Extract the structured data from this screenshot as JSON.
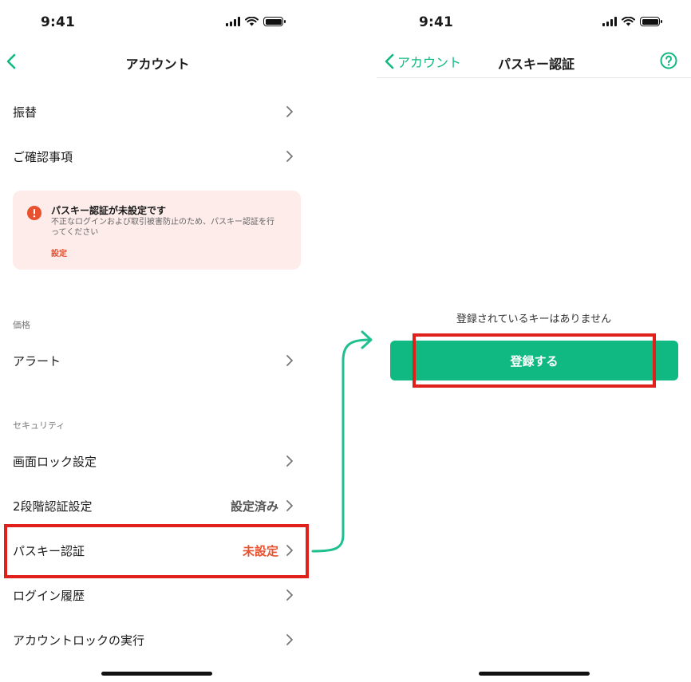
{
  "left_screen": {
    "status_time": "9:41",
    "nav_title": "アカウント",
    "rows_top": [
      {
        "label": "振替"
      },
      {
        "label": "ご確認事項"
      }
    ],
    "alert": {
      "title": "パスキー認証が未設定です",
      "body": "不正なログインおよび取引被害防止のため、パスキー認証を行ってください",
      "link": "設定"
    },
    "section_price": "価格",
    "alert_row": {
      "label": "アラート"
    },
    "section_security": "セキュリティ",
    "security_rows": [
      {
        "label": "画面ロック設定",
        "value": ""
      },
      {
        "label": "2段階認証設定",
        "value": "設定済み"
      },
      {
        "label": "パスキー認証",
        "value": "未設定"
      },
      {
        "label": "ログイン履歴",
        "value": ""
      },
      {
        "label": "アカウントロックの実行",
        "value": ""
      }
    ]
  },
  "right_screen": {
    "status_time": "9:41",
    "back_label": "アカウント",
    "nav_title": "パスキー認証",
    "empty_message": "登録されているキーはありません",
    "register_button": "登録する"
  },
  "colors": {
    "accent": "#10b981",
    "warning": "#e8502e",
    "highlight": "#e0201a",
    "alert_bg": "#fdecea"
  },
  "icons": [
    "chevron-left-icon",
    "chevron-right-icon",
    "exclamation-circle-icon",
    "question-circle-icon",
    "signal-icon",
    "wifi-icon",
    "battery-icon",
    "flow-arrow-icon"
  ]
}
